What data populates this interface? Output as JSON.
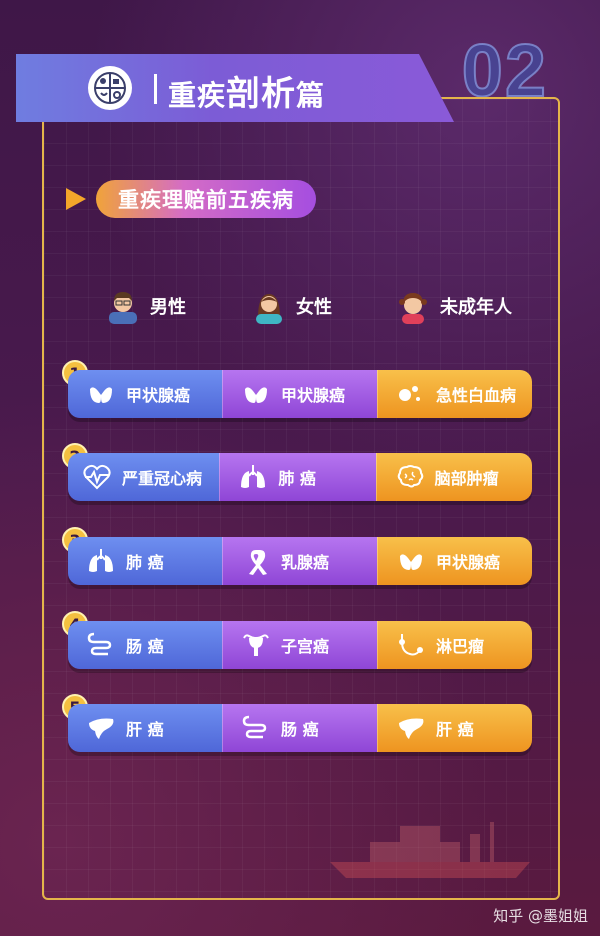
{
  "header": {
    "number": "02",
    "title_part1": "重疾",
    "title_part2": "剖析",
    "title_part3": "篇",
    "logo": "brain-medical-logo"
  },
  "section": {
    "label": "重疾理赔前五疾病"
  },
  "groups": [
    {
      "label": "男性",
      "icon": "male-avatar"
    },
    {
      "label": "女性",
      "icon": "female-avatar"
    },
    {
      "label": "未成年人",
      "icon": "child-avatar"
    }
  ],
  "rows": [
    {
      "rank": "1",
      "cells": [
        {
          "label": "甲状腺癌",
          "icon": "thyroid-icon"
        },
        {
          "label": "甲状腺癌",
          "icon": "thyroid-icon"
        },
        {
          "label": "急性白血病",
          "icon": "blood-cells-icon"
        }
      ]
    },
    {
      "rank": "2",
      "cells": [
        {
          "label": "严重冠心病",
          "icon": "heart-pulse-icon"
        },
        {
          "label": "肺 癌",
          "icon": "lungs-icon"
        },
        {
          "label": "脑部肿瘤",
          "icon": "brain-icon"
        }
      ]
    },
    {
      "rank": "3",
      "cells": [
        {
          "label": "肺 癌",
          "icon": "lungs-icon"
        },
        {
          "label": "乳腺癌",
          "icon": "ribbon-icon"
        },
        {
          "label": "甲状腺癌",
          "icon": "thyroid-icon"
        }
      ]
    },
    {
      "rank": "4",
      "cells": [
        {
          "label": "肠 癌",
          "icon": "intestine-icon"
        },
        {
          "label": "子宫癌",
          "icon": "uterus-icon"
        },
        {
          "label": "淋巴瘤",
          "icon": "lymph-icon"
        }
      ]
    },
    {
      "rank": "5",
      "cells": [
        {
          "label": "肝 癌",
          "icon": "liver-icon"
        },
        {
          "label": "肠 癌",
          "icon": "intestine-icon"
        },
        {
          "label": "肝 癌",
          "icon": "liver-icon"
        }
      ]
    }
  ],
  "watermark": "知乎 @墨姐姐"
}
